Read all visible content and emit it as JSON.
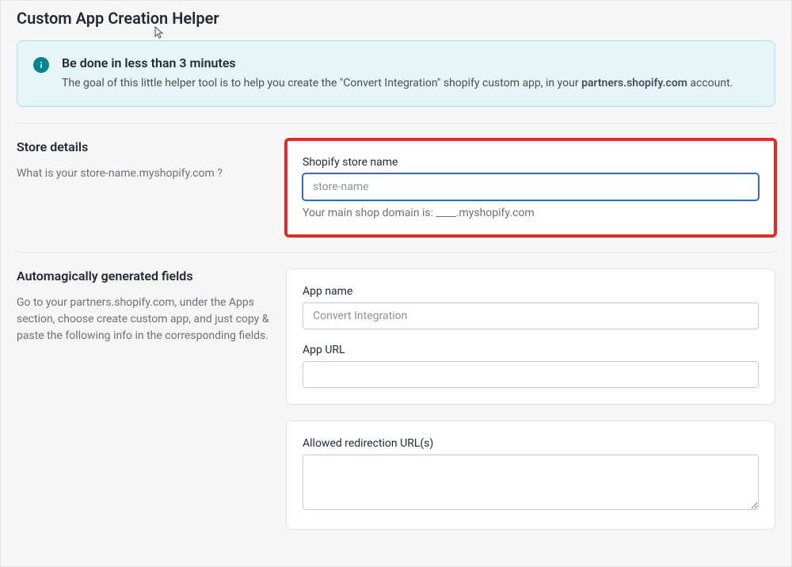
{
  "page": {
    "title": "Custom App Creation Helper"
  },
  "banner": {
    "title": "Be done in less than 3 minutes",
    "text_prefix": "The goal of this little helper tool is to help you create the \"Convert Integration\" shopify custom app, in your ",
    "text_bold": "partners.shopify.com",
    "text_suffix": " account."
  },
  "sections": {
    "store_details": {
      "heading": "Store details",
      "description": "What is your store-name.myshopify.com ?",
      "field_label": "Shopify store name",
      "field_placeholder": "store-name",
      "help_text": "Your main shop domain is: ____.myshopify.com"
    },
    "generated": {
      "heading": "Automagically generated fields",
      "description": "Go to your partners.shopify.com, under the Apps section, choose create custom app, and just copy & paste the following info in the corresponding fields.",
      "app_name_label": "App name",
      "app_name_placeholder": "Convert Integration",
      "app_url_label": "App URL",
      "redirect_label": "Allowed redirection URL(s)"
    }
  }
}
